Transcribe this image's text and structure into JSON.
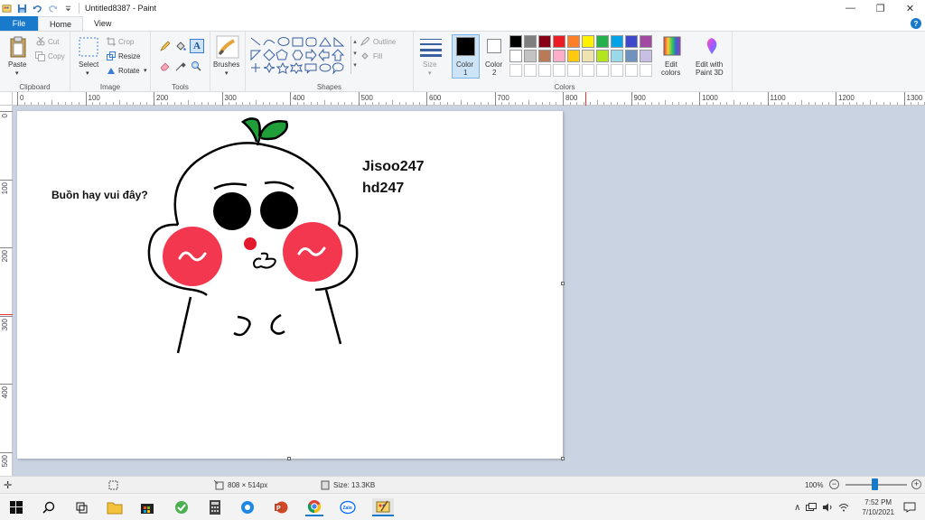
{
  "titlebar": {
    "title": "Untitled8387 - Paint",
    "qa_icons": [
      "paint-app-icon",
      "save-icon",
      "undo-icon",
      "redo-icon",
      "customize-icon"
    ]
  },
  "tabs": {
    "file": "File",
    "home": "Home",
    "view": "View"
  },
  "ribbon": {
    "clipboard": {
      "paste": "Paste",
      "cut": "Cut",
      "copy": "Copy",
      "label": "Clipboard"
    },
    "image": {
      "select": "Select",
      "crop": "Crop",
      "resize": "Resize",
      "rotate": "Rotate",
      "label": "Image"
    },
    "tools": {
      "label": "Tools"
    },
    "brushes": {
      "label": "Brushes"
    },
    "shapes": {
      "outline": "Outline",
      "fill": "Fill",
      "label": "Shapes"
    },
    "size": {
      "label": "Size"
    },
    "colors": {
      "color1": "Color 1",
      "color1_l1": "Color",
      "color1_l2": "1",
      "color2_l1": "Color",
      "color2_l2": "2",
      "edit_l1": "Edit",
      "edit_l2": "colors",
      "paint3d_l1": "Edit with",
      "paint3d_l2": "Paint 3D",
      "label": "Colors",
      "row1": [
        "#000000",
        "#7f7f7f",
        "#880015",
        "#ed1c24",
        "#ff7f27",
        "#fff200",
        "#22b14c",
        "#00a2e8",
        "#3f48cc",
        "#a349a4"
      ],
      "row2": [
        "#ffffff",
        "#c3c3c3",
        "#b97a57",
        "#ffaec9",
        "#ffc90e",
        "#efe4b0",
        "#b5e61d",
        "#99d9ea",
        "#7092be",
        "#c8bfe7"
      ],
      "color1_value": "#000000",
      "color2_value": "#ffffff"
    }
  },
  "ruler": {
    "h_ticks": [
      "0",
      "100",
      "200",
      "300",
      "400",
      "500",
      "600",
      "700",
      "800",
      "900",
      "1000",
      "1100",
      "1200",
      "1300"
    ],
    "v_ticks": [
      "0",
      "100",
      "200",
      "300",
      "400",
      "500"
    ]
  },
  "canvas": {
    "text_left": "Buồn hay vui đây?",
    "text_right_1": "Jisoo247",
    "text_right_2": "hd247"
  },
  "status": {
    "dimensions": "808 × 514px",
    "size": "Size: 13.3KB",
    "zoom": "100%"
  },
  "taskbar": {
    "time": "7:52 PM",
    "date": "7/10/2021",
    "apps": [
      "windows-start-icon",
      "search-icon",
      "task-view-icon",
      "file-explorer-icon",
      "store-icon",
      "green-app-icon",
      "calculator-icon",
      "blue-app-icon",
      "powerpoint-icon",
      "chrome-icon",
      "zalo-icon",
      "paint-icon"
    ]
  }
}
